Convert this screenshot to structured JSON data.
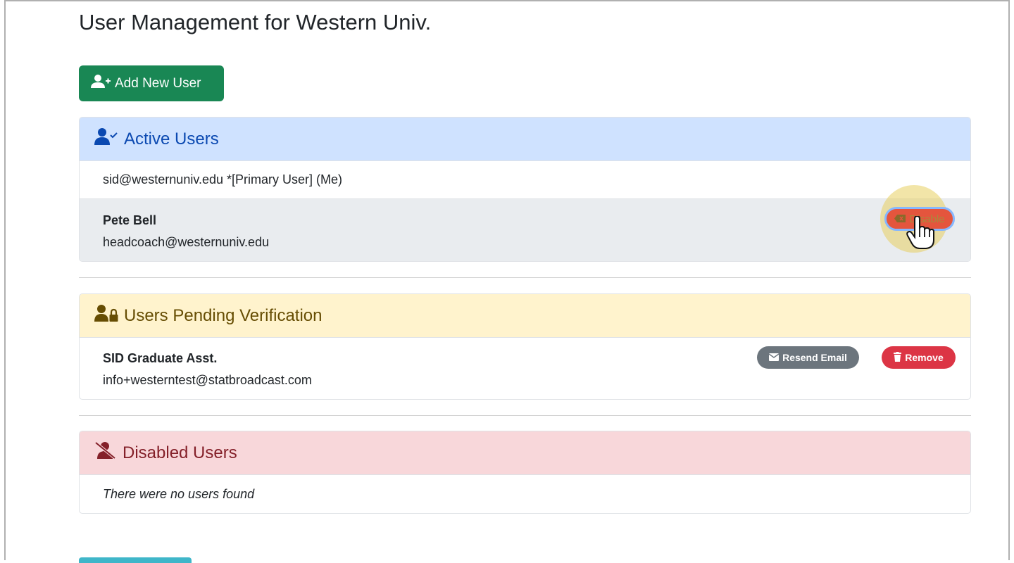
{
  "page": {
    "title": "User Management for Western Univ."
  },
  "toolbar": {
    "add_user_label": "Add New User"
  },
  "active": {
    "header": "Active Users",
    "primary_row": "sid@westernuniv.edu *[Primary User] (Me)",
    "users": [
      {
        "name": "Pete Bell",
        "email": "headcoach@westernuniv.edu",
        "action_label": "Disable"
      }
    ]
  },
  "pending": {
    "header": "Users Pending Verification",
    "users": [
      {
        "name": "SID Graduate Asst.",
        "email": "info+westerntest@statbroadcast.com",
        "resend_label": "Resend Email",
        "remove_label": "Remove"
      }
    ]
  },
  "disabled": {
    "header": "Disabled Users",
    "empty_text": "There were no users found"
  },
  "colors": {
    "success": "#198754",
    "info_header": "#cfe2ff",
    "warning_header": "#fff3cd",
    "danger_header": "#f8d7da",
    "danger": "#dc3545",
    "secondary": "#6c757d"
  },
  "icons": [
    "user-plus-icon",
    "user-check-icon",
    "user-lock-icon",
    "user-slash-icon",
    "envelope-icon",
    "trash-icon",
    "backspace-icon",
    "hand-pointer-icon"
  ]
}
